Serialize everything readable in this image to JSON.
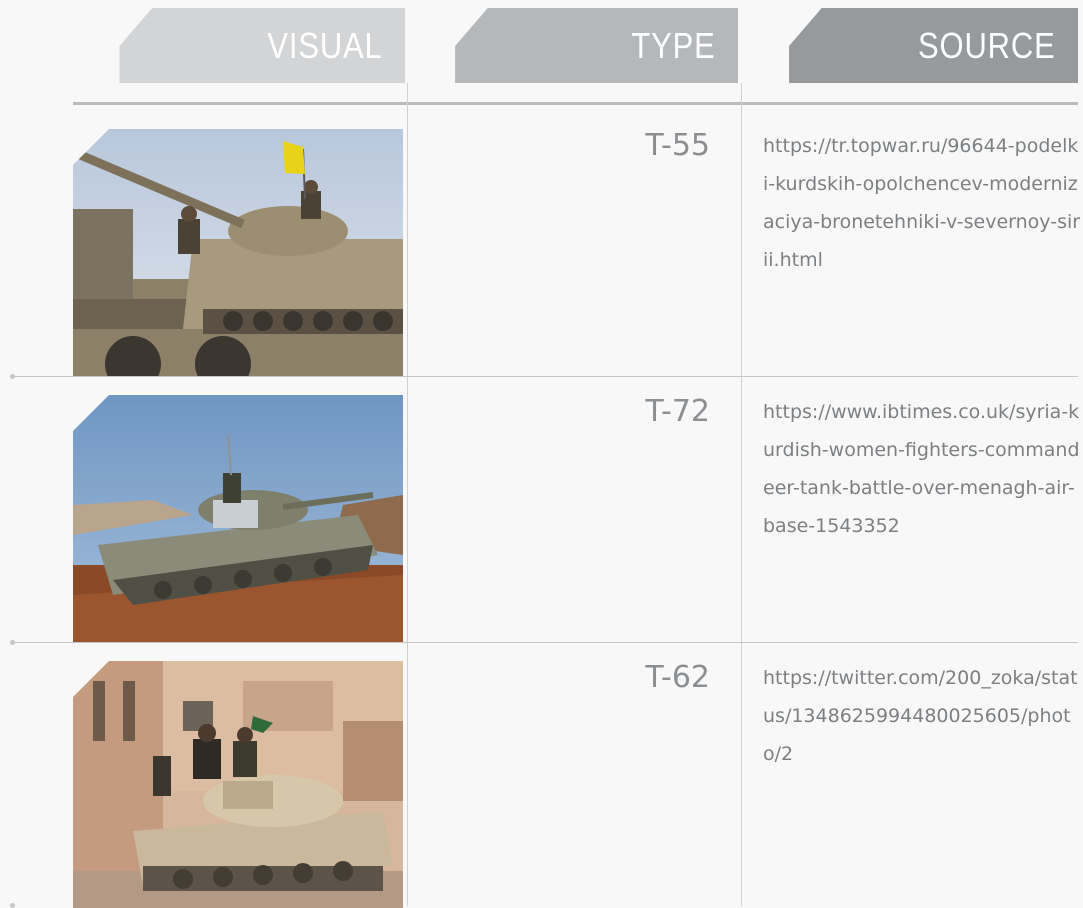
{
  "header": {
    "visual": "VISUAL",
    "type": "TYPE",
    "source": "SOURCE"
  },
  "rows": [
    {
      "type": "T-55",
      "source": "https://tr.topwar.ru/96644-podelki-kurdskih-opolchencev-modernizaciya-bronetehniki-v-severnoy-sirii.html",
      "photo": "tank-on-truck-trailer-photo"
    },
    {
      "type": "T-72",
      "source": "https://www.ibtimes.co.uk/syria-kurdish-women-fighters-commandeer-tank-battle-over-menagh-air-base-1543352",
      "photo": "tank-on-dirt-road-photo"
    },
    {
      "type": "T-62",
      "source": "https://twitter.com/200_zoka/status/1348625994480025605/photo/2",
      "photo": "tank-in-town-photo"
    }
  ],
  "colors": {
    "background": "#f8f8f8",
    "header_visual": "#d3d4d6",
    "header_type": "#b5b8bb",
    "header_source": "#979a9d",
    "text": "#7d8083"
  }
}
